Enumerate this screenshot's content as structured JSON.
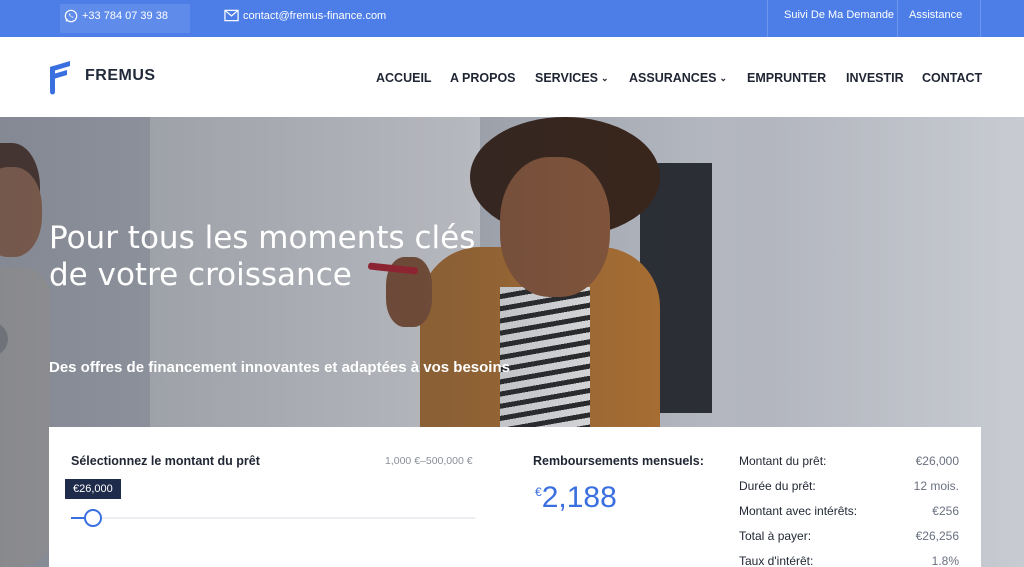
{
  "topbar": {
    "phone_icon": "whatsapp-icon",
    "phone": "+33 784 07 39 38",
    "email_icon": "mail-icon",
    "email": "contact@fremus-finance.com",
    "links": [
      "Suivi De Ma Demande",
      "Assistance"
    ]
  },
  "header": {
    "logo_text": "FREMUS",
    "nav": [
      {
        "label": "ACCUEIL",
        "has_dropdown": false
      },
      {
        "label": "A PROPOS",
        "has_dropdown": false
      },
      {
        "label": "SERVICES",
        "has_dropdown": true
      },
      {
        "label": "ASSURANCES",
        "has_dropdown": true
      },
      {
        "label": "EMPRUNTER",
        "has_dropdown": false
      },
      {
        "label": "INVESTIR",
        "has_dropdown": false
      },
      {
        "label": "CONTACT",
        "has_dropdown": false
      }
    ]
  },
  "hero": {
    "title_line1": "Pour tous les moments clés",
    "title_line2": "de votre croissance",
    "subtitle": "Des offres de financement innovantes et adaptées à vos besoins"
  },
  "calculator": {
    "amount_label": "Sélectionnez le montant du prêt",
    "range": "1,000 €–500,000 €",
    "selected_amount": "€26,000",
    "slider_fraction": 0.05,
    "monthly_label": "Remboursements mensuels:",
    "monthly_currency": "€",
    "monthly_value": "2,188",
    "summary": [
      {
        "label": "Montant du prêt:",
        "value": "€26,000"
      },
      {
        "label": "Durée du prêt:",
        "value": "12 mois."
      },
      {
        "label": "Montant avec intérêts:",
        "value": "€256"
      },
      {
        "label": "Total à payer:",
        "value": "€26,256"
      },
      {
        "label": "Taux d'intérêt:",
        "value": "1.8%"
      }
    ]
  },
  "colors": {
    "topbar_bg": "#4d7ee8",
    "accent": "#3a6fe0",
    "badge_bg": "#1f2b4a",
    "text_dark": "#1f2533"
  }
}
